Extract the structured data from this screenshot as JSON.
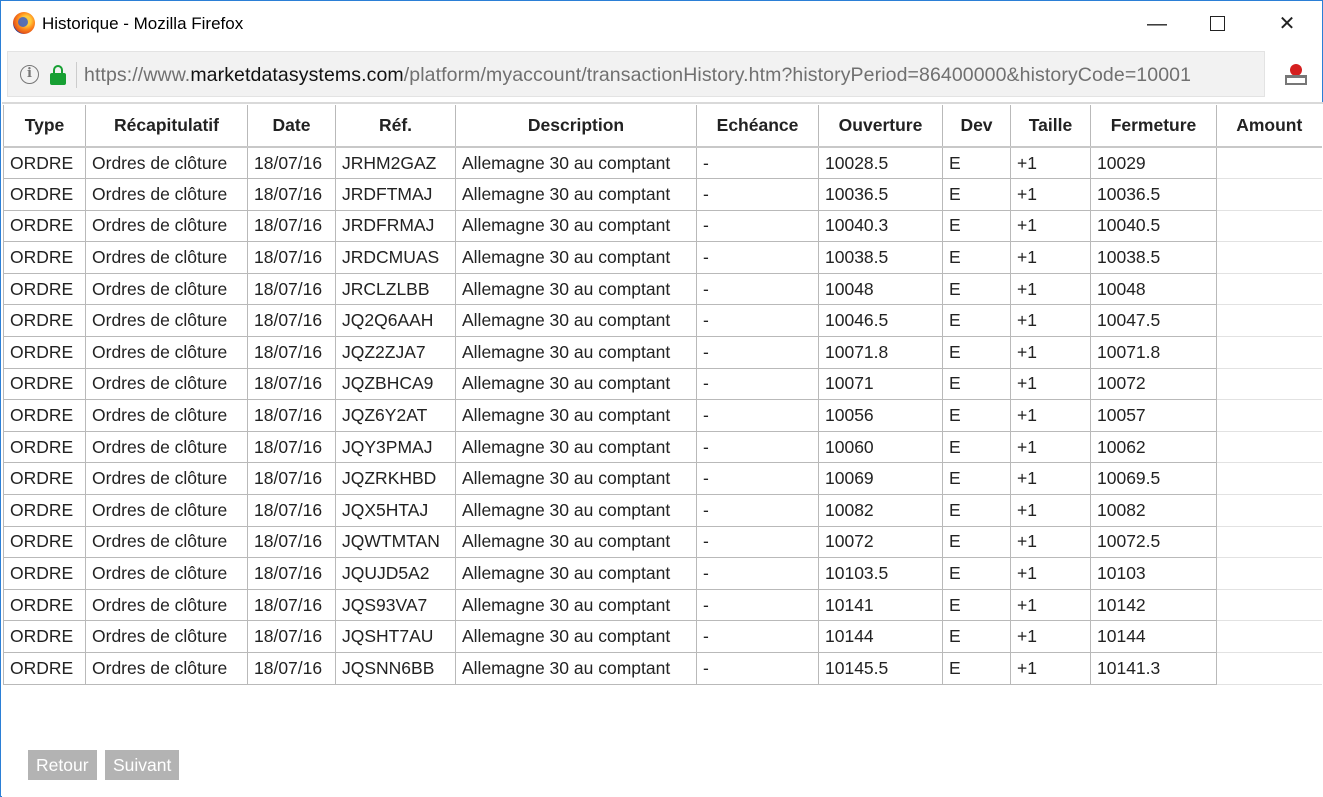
{
  "window": {
    "title": "Historique - Mozilla Firefox",
    "controls": {
      "minimize": "—",
      "close": "✕"
    }
  },
  "urlbar": {
    "url_prefix": "https://www.",
    "url_host": "marketdatasystems.com",
    "url_path": "/platform/myaccount/transactionHistory.htm?historyPeriod=86400000&historyCode=10001",
    "info_glyph": "i"
  },
  "table": {
    "headers": [
      "Type",
      "Récapitulatif",
      "Date",
      "Réf.",
      "Description",
      "Echéance",
      "Ouverture",
      "Dev",
      "Taille",
      "Fermeture",
      "Amount"
    ],
    "rows": [
      [
        "ORDRE",
        "Ordres de clôture",
        "18/07/16",
        "JRHM2GAZ",
        "Allemagne 30 au comptant",
        "-",
        "10028.5",
        "E",
        "+1",
        "10029"
      ],
      [
        "ORDRE",
        "Ordres de clôture",
        "18/07/16",
        "JRDFTMAJ",
        "Allemagne 30 au comptant",
        "-",
        "10036.5",
        "E",
        "+1",
        "10036.5"
      ],
      [
        "ORDRE",
        "Ordres de clôture",
        "18/07/16",
        "JRDFRMAJ",
        "Allemagne 30 au comptant",
        "-",
        "10040.3",
        "E",
        "+1",
        "10040.5"
      ],
      [
        "ORDRE",
        "Ordres de clôture",
        "18/07/16",
        "JRDCMUAS",
        "Allemagne 30 au comptant",
        "-",
        "10038.5",
        "E",
        "+1",
        "10038.5"
      ],
      [
        "ORDRE",
        "Ordres de clôture",
        "18/07/16",
        "JRCLZLBB",
        "Allemagne 30 au comptant",
        "-",
        "10048",
        "E",
        "+1",
        "10048"
      ],
      [
        "ORDRE",
        "Ordres de clôture",
        "18/07/16",
        "JQ2Q6AAH",
        "Allemagne 30 au comptant",
        "-",
        "10046.5",
        "E",
        "+1",
        "10047.5"
      ],
      [
        "ORDRE",
        "Ordres de clôture",
        "18/07/16",
        "JQZ2ZJA7",
        "Allemagne 30 au comptant",
        "-",
        "10071.8",
        "E",
        "+1",
        "10071.8"
      ],
      [
        "ORDRE",
        "Ordres de clôture",
        "18/07/16",
        "JQZBHCA9",
        "Allemagne 30 au comptant",
        "-",
        "10071",
        "E",
        "+1",
        "10072"
      ],
      [
        "ORDRE",
        "Ordres de clôture",
        "18/07/16",
        "JQZ6Y2AT",
        "Allemagne 30 au comptant",
        "-",
        "10056",
        "E",
        "+1",
        "10057"
      ],
      [
        "ORDRE",
        "Ordres de clôture",
        "18/07/16",
        "JQY3PMAJ",
        "Allemagne 30 au comptant",
        "-",
        "10060",
        "E",
        "+1",
        "10062"
      ],
      [
        "ORDRE",
        "Ordres de clôture",
        "18/07/16",
        "JQZRKHBD",
        "Allemagne 30 au comptant",
        "-",
        "10069",
        "E",
        "+1",
        "10069.5"
      ],
      [
        "ORDRE",
        "Ordres de clôture",
        "18/07/16",
        "JQX5HTAJ",
        "Allemagne 30 au comptant",
        "-",
        "10082",
        "E",
        "+1",
        "10082"
      ],
      [
        "ORDRE",
        "Ordres de clôture",
        "18/07/16",
        "JQWTMTAN",
        "Allemagne 30 au comptant",
        "-",
        "10072",
        "E",
        "+1",
        "10072.5"
      ],
      [
        "ORDRE",
        "Ordres de clôture",
        "18/07/16",
        "JQUJD5A2",
        "Allemagne 30 au comptant",
        "-",
        "10103.5",
        "E",
        "+1",
        "10103"
      ],
      [
        "ORDRE",
        "Ordres de clôture",
        "18/07/16",
        "JQS93VA7",
        "Allemagne 30 au comptant",
        "-",
        "10141",
        "E",
        "+1",
        "10142"
      ],
      [
        "ORDRE",
        "Ordres de clôture",
        "18/07/16",
        "JQSHT7AU",
        "Allemagne 30 au comptant",
        "-",
        "10144",
        "E",
        "+1",
        "10144"
      ],
      [
        "ORDRE",
        "Ordres de clôture",
        "18/07/16",
        "JQSNN6BB",
        "Allemagne 30 au comptant",
        "-",
        "10145.5",
        "E",
        "+1",
        "10141.3"
      ]
    ]
  },
  "pagination": {
    "back_label": "Retour",
    "next_label": "Suivant"
  },
  "colors": {
    "lock": "#17a033",
    "button_bg": "#b3b3b3",
    "window_border": "#2b7fd6"
  }
}
